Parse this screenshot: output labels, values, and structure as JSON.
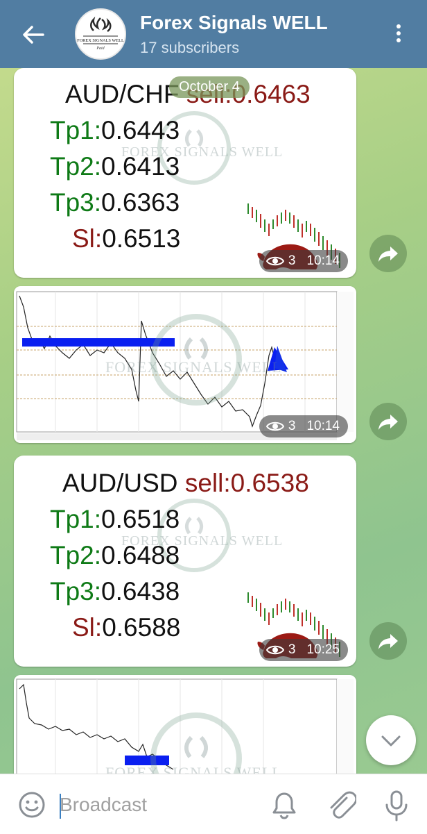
{
  "header": {
    "title": "Forex Signals WELL",
    "subtitle": "17 subscribers",
    "avatar_text": "FOREX SIGNALS WELL",
    "avatar_sub": "Paid"
  },
  "date_pill": "October 4",
  "posts": [
    {
      "pair": "AUD/CHF",
      "direction": "sell:",
      "entry": "0.6463",
      "tp1_label": "Tp1:",
      "tp1": "0.6443",
      "tp2_label": "Tp2:",
      "tp2": "0.6413",
      "tp3_label": "Tp3:",
      "tp3": "0.6363",
      "sl_label": "Sl:",
      "sl": "0.6513",
      "views": "3",
      "time": "10:14"
    },
    {
      "views": "3",
      "time": "10:14"
    },
    {
      "pair": "AUD/USD",
      "direction": "sell:",
      "entry": "0.6538",
      "tp1_label": "Tp1:",
      "tp1": "0.6518",
      "tp2_label": "Tp2:",
      "tp2": "0.6488",
      "tp3_label": "Tp3:",
      "tp3": "0.6438",
      "sl_label": "Sl:",
      "sl": "0.6588",
      "views": "3",
      "time": "10:25"
    }
  ],
  "watermark": "FOREX SIGNALS WELL",
  "input": {
    "placeholder": "Broadcast"
  },
  "icons": {
    "back": "arrow-left-icon",
    "menu": "kebab-menu-icon",
    "share": "share-forward-icon",
    "emoji": "emoji-icon",
    "bell": "bell-icon",
    "attach": "paperclip-icon",
    "mic": "microphone-icon",
    "scroll": "chevron-down-icon"
  },
  "colors": {
    "header": "#517da2",
    "tp_green": "#0e7a16",
    "sell_red": "#8a1a16"
  }
}
